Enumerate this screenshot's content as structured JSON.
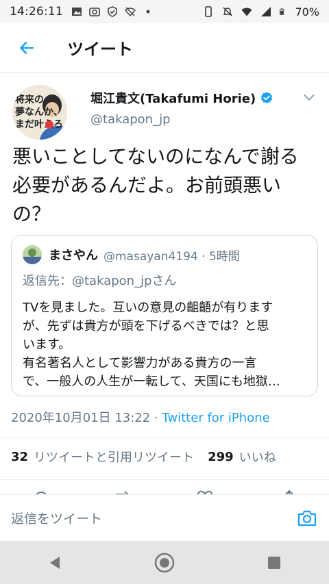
{
  "status_bar": {
    "time": "14:26:11",
    "battery": "70%",
    "icons": [
      "image-icon",
      "camera-icon",
      "shield-icon",
      "wifi-off-icon",
      "dot-icon",
      "phone-icon",
      "mute-icon",
      "wifi-icon",
      "signal-icon",
      "battery-icon"
    ]
  },
  "header": {
    "title": "ツイート",
    "back_icon": "arrow-left-icon"
  },
  "tweet": {
    "author_name": "堀江貴文(Takafumi Horie)",
    "author_handle": "@takapon_jp",
    "avatar_text": "将来の夢なんか、まだ叶えろ",
    "text_lines": [
      "悪いことしてないのになんで謝る",
      "必要があるんだよ。お前頭悪い",
      "の？"
    ],
    "timestamp": "2020年10月01日 13:22",
    "separator": " · ",
    "client": "Twitter for iPhone"
  },
  "quote": {
    "name": "まさやん",
    "handle": "@masayan4194 · 5時間",
    "reply_to": "返信先：@takapon_jpさん",
    "lines": [
      "TVを見ました。互いの意見の齟齬が有ります",
      "が、先ずは貴方が頭を下げるべきでは？と思",
      "います。",
      "有名著名人として影響力がある貴方の一言",
      "で、一般人の人生が一転して、天国にも地獄…"
    ]
  },
  "stats": {
    "retweets_count": "32",
    "retweets_label": "リツイートと引用リツイート",
    "likes_count": "299",
    "likes_label": "いいね"
  },
  "reply_bar": {
    "placeholder": "返信をツイート"
  },
  "colors": {
    "accent": "#1da1f2",
    "secondary_text": "#657786",
    "border": "#e6ecf0"
  }
}
